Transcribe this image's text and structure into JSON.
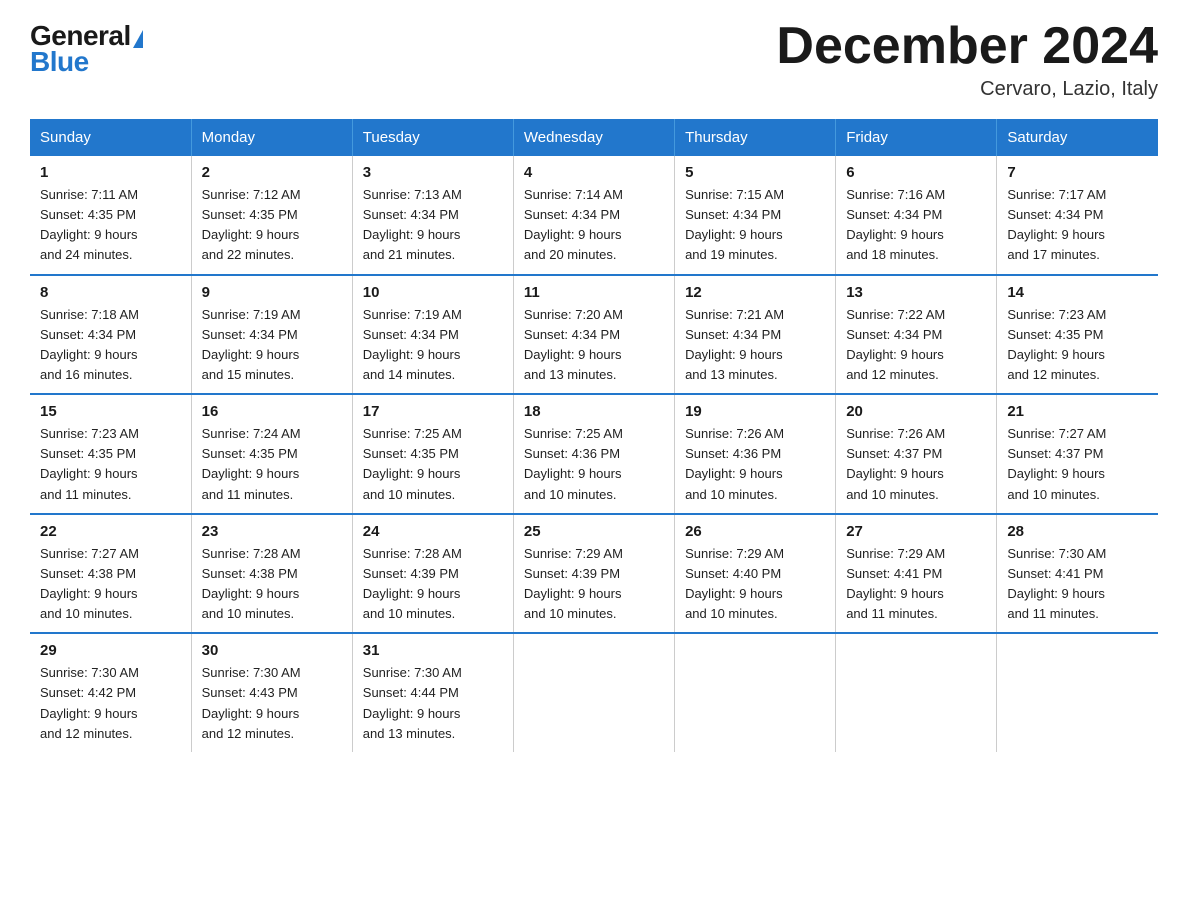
{
  "logo": {
    "general": "General",
    "blue": "Blue"
  },
  "title": {
    "month_year": "December 2024",
    "location": "Cervaro, Lazio, Italy"
  },
  "header_days": [
    "Sunday",
    "Monday",
    "Tuesday",
    "Wednesday",
    "Thursday",
    "Friday",
    "Saturday"
  ],
  "weeks": [
    [
      {
        "num": "1",
        "sunrise": "7:11 AM",
        "sunset": "4:35 PM",
        "daylight": "9 hours and 24 minutes."
      },
      {
        "num": "2",
        "sunrise": "7:12 AM",
        "sunset": "4:35 PM",
        "daylight": "9 hours and 22 minutes."
      },
      {
        "num": "3",
        "sunrise": "7:13 AM",
        "sunset": "4:34 PM",
        "daylight": "9 hours and 21 minutes."
      },
      {
        "num": "4",
        "sunrise": "7:14 AM",
        "sunset": "4:34 PM",
        "daylight": "9 hours and 20 minutes."
      },
      {
        "num": "5",
        "sunrise": "7:15 AM",
        "sunset": "4:34 PM",
        "daylight": "9 hours and 19 minutes."
      },
      {
        "num": "6",
        "sunrise": "7:16 AM",
        "sunset": "4:34 PM",
        "daylight": "9 hours and 18 minutes."
      },
      {
        "num": "7",
        "sunrise": "7:17 AM",
        "sunset": "4:34 PM",
        "daylight": "9 hours and 17 minutes."
      }
    ],
    [
      {
        "num": "8",
        "sunrise": "7:18 AM",
        "sunset": "4:34 PM",
        "daylight": "9 hours and 16 minutes."
      },
      {
        "num": "9",
        "sunrise": "7:19 AM",
        "sunset": "4:34 PM",
        "daylight": "9 hours and 15 minutes."
      },
      {
        "num": "10",
        "sunrise": "7:19 AM",
        "sunset": "4:34 PM",
        "daylight": "9 hours and 14 minutes."
      },
      {
        "num": "11",
        "sunrise": "7:20 AM",
        "sunset": "4:34 PM",
        "daylight": "9 hours and 13 minutes."
      },
      {
        "num": "12",
        "sunrise": "7:21 AM",
        "sunset": "4:34 PM",
        "daylight": "9 hours and 13 minutes."
      },
      {
        "num": "13",
        "sunrise": "7:22 AM",
        "sunset": "4:34 PM",
        "daylight": "9 hours and 12 minutes."
      },
      {
        "num": "14",
        "sunrise": "7:23 AM",
        "sunset": "4:35 PM",
        "daylight": "9 hours and 12 minutes."
      }
    ],
    [
      {
        "num": "15",
        "sunrise": "7:23 AM",
        "sunset": "4:35 PM",
        "daylight": "9 hours and 11 minutes."
      },
      {
        "num": "16",
        "sunrise": "7:24 AM",
        "sunset": "4:35 PM",
        "daylight": "9 hours and 11 minutes."
      },
      {
        "num": "17",
        "sunrise": "7:25 AM",
        "sunset": "4:35 PM",
        "daylight": "9 hours and 10 minutes."
      },
      {
        "num": "18",
        "sunrise": "7:25 AM",
        "sunset": "4:36 PM",
        "daylight": "9 hours and 10 minutes."
      },
      {
        "num": "19",
        "sunrise": "7:26 AM",
        "sunset": "4:36 PM",
        "daylight": "9 hours and 10 minutes."
      },
      {
        "num": "20",
        "sunrise": "7:26 AM",
        "sunset": "4:37 PM",
        "daylight": "9 hours and 10 minutes."
      },
      {
        "num": "21",
        "sunrise": "7:27 AM",
        "sunset": "4:37 PM",
        "daylight": "9 hours and 10 minutes."
      }
    ],
    [
      {
        "num": "22",
        "sunrise": "7:27 AM",
        "sunset": "4:38 PM",
        "daylight": "9 hours and 10 minutes."
      },
      {
        "num": "23",
        "sunrise": "7:28 AM",
        "sunset": "4:38 PM",
        "daylight": "9 hours and 10 minutes."
      },
      {
        "num": "24",
        "sunrise": "7:28 AM",
        "sunset": "4:39 PM",
        "daylight": "9 hours and 10 minutes."
      },
      {
        "num": "25",
        "sunrise": "7:29 AM",
        "sunset": "4:39 PM",
        "daylight": "9 hours and 10 minutes."
      },
      {
        "num": "26",
        "sunrise": "7:29 AM",
        "sunset": "4:40 PM",
        "daylight": "9 hours and 10 minutes."
      },
      {
        "num": "27",
        "sunrise": "7:29 AM",
        "sunset": "4:41 PM",
        "daylight": "9 hours and 11 minutes."
      },
      {
        "num": "28",
        "sunrise": "7:30 AM",
        "sunset": "4:41 PM",
        "daylight": "9 hours and 11 minutes."
      }
    ],
    [
      {
        "num": "29",
        "sunrise": "7:30 AM",
        "sunset": "4:42 PM",
        "daylight": "9 hours and 12 minutes."
      },
      {
        "num": "30",
        "sunrise": "7:30 AM",
        "sunset": "4:43 PM",
        "daylight": "9 hours and 12 minutes."
      },
      {
        "num": "31",
        "sunrise": "7:30 AM",
        "sunset": "4:44 PM",
        "daylight": "9 hours and 13 minutes."
      },
      null,
      null,
      null,
      null
    ]
  ]
}
